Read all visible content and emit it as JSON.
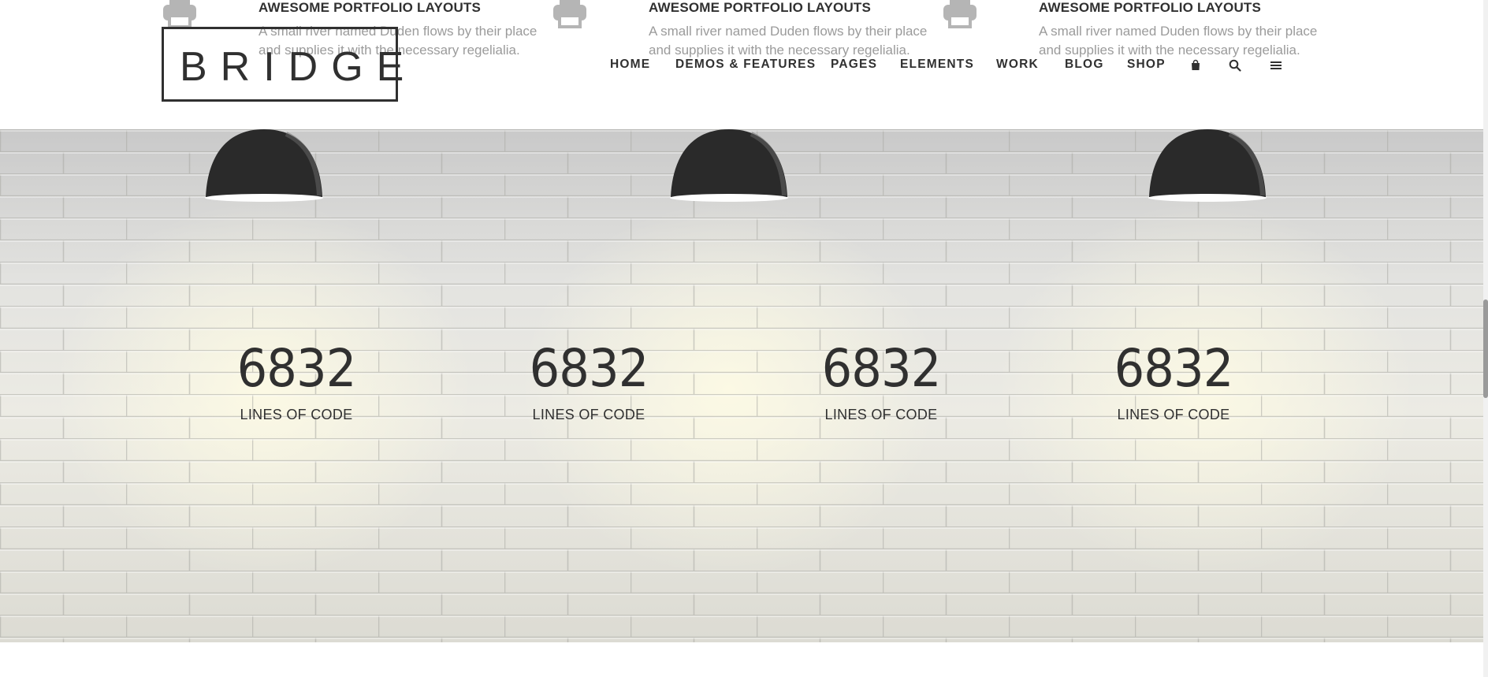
{
  "features": [
    {
      "title": "AWESOME PORTFOLIO LAYOUTS",
      "text": "A small river named Duden flows by their place and supplies it with the necessary regelialia.",
      "icon": "printer-icon"
    },
    {
      "title": "AWESOME PORTFOLIO LAYOUTS",
      "text": "A small river named Duden flows by their place and supplies it with the necessary regelialia.",
      "icon": "printer-icon"
    },
    {
      "title": "AWESOME PORTFOLIO LAYOUTS",
      "text": "A small river named Duden flows by their place and supplies it with the necessary regelialia.",
      "icon": "printer-icon"
    }
  ],
  "header": {
    "logo": "BRIDGE",
    "nav": [
      "HOME",
      "DEMOS & FEATURES",
      "PAGES",
      "ELEMENTS",
      "WORK",
      "BLOG",
      "SHOP"
    ],
    "icons": [
      "shopping-bag-icon",
      "search-icon",
      "menu-icon"
    ]
  },
  "counters": [
    {
      "value": "6832",
      "label": "LINES OF CODE"
    },
    {
      "value": "6832",
      "label": "LINES OF CODE"
    },
    {
      "value": "6832",
      "label": "LINES OF CODE"
    },
    {
      "value": "6832",
      "label": "LINES OF CODE"
    }
  ],
  "colors": {
    "text": "#303030",
    "muted": "#9b9b9b",
    "icon": "#b5b5b5"
  }
}
